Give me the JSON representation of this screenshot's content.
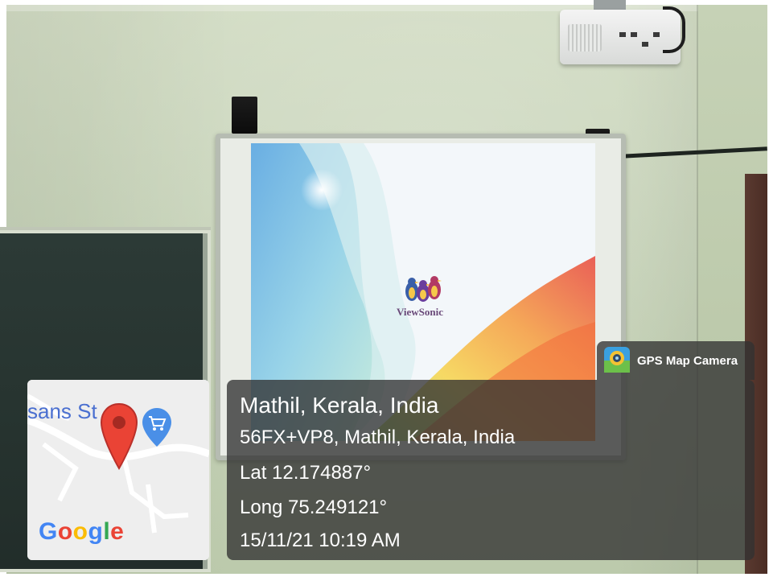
{
  "screen": {
    "brand_text": "ViewSonic"
  },
  "overlay": {
    "app_name": "GPS Map Camera",
    "place": "Mathil, Kerala, India",
    "address": "56FX+VP8, Mathil, Kerala, India",
    "latitude": "Lat 12.174887°",
    "longitude": "Long 75.249121°",
    "datetime": "15/11/21 10:19 AM"
  },
  "map": {
    "street_label": "sans St",
    "provider": "Google",
    "provider_letters": [
      "G",
      "o",
      "o",
      "g",
      "l",
      "e"
    ],
    "provider_colors": [
      "#4285F4",
      "#EA4335",
      "#FBBC05",
      "#4285F4",
      "#34A853",
      "#EA4335"
    ],
    "pin_icon": "location-pin-icon",
    "poi_icon": "shopping-cart-icon"
  },
  "colors": {
    "pin_red": "#EA4335",
    "poi_blue": "#4A8FE7",
    "overlay_bg": "#323232"
  }
}
